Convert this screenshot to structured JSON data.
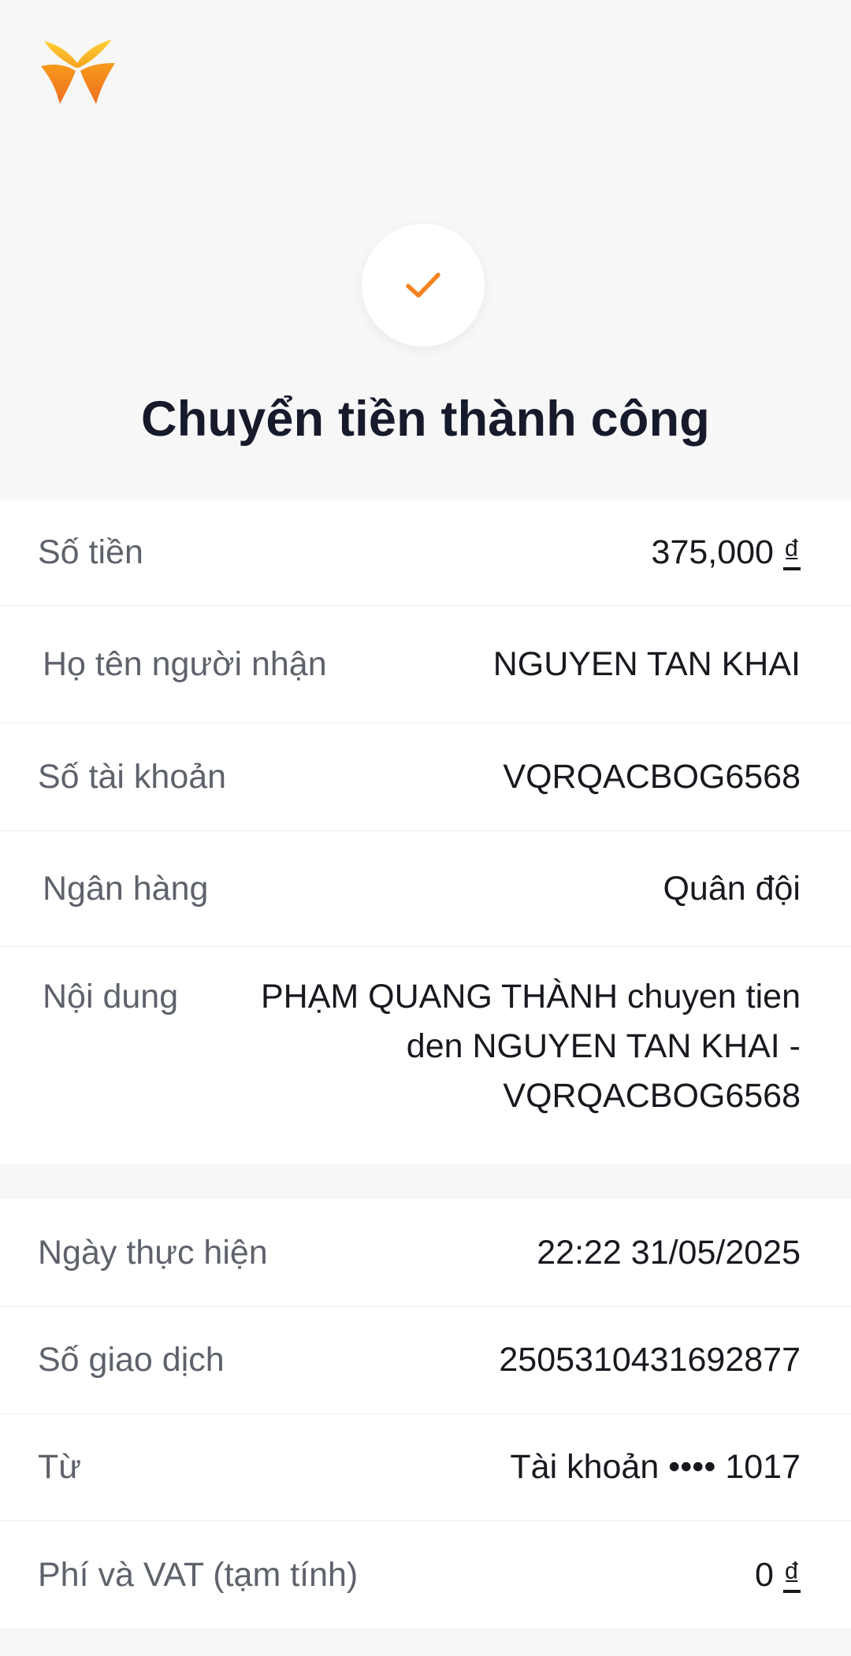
{
  "header": {
    "title": "Chuyển tiền thành công",
    "accent_color": "#f58220",
    "logo_icon": "vpbank-butterfly-logo",
    "status_icon": "checkmark-icon"
  },
  "transfer_details": {
    "amount": {
      "label": "Số tiền",
      "value": "375,000",
      "currency": "₫"
    },
    "recipient_name": {
      "label": "Họ tên người nhận",
      "value": "NGUYEN TAN KHAI"
    },
    "account_number": {
      "label": "Số tài khoản",
      "value": "VQRQACBOG6568"
    },
    "bank": {
      "label": "Ngân hàng",
      "value": "Quân đội"
    },
    "content": {
      "label": "Nội dung",
      "value": "PHẠM QUANG THÀNH chuyen tien den NGUYEN TAN KHAI - VQRQACBOG6568"
    }
  },
  "transaction_info": {
    "date": {
      "label": "Ngày thực hiện",
      "value": "22:22 31/05/2025"
    },
    "transaction_id": {
      "label": "Số giao dịch",
      "value": "2505310431692877"
    },
    "from": {
      "label": "Từ",
      "value": "Tài khoản •••• 1017"
    },
    "fee": {
      "label": "Phí và VAT (tạm tính)",
      "value": "0",
      "currency": "₫"
    }
  }
}
